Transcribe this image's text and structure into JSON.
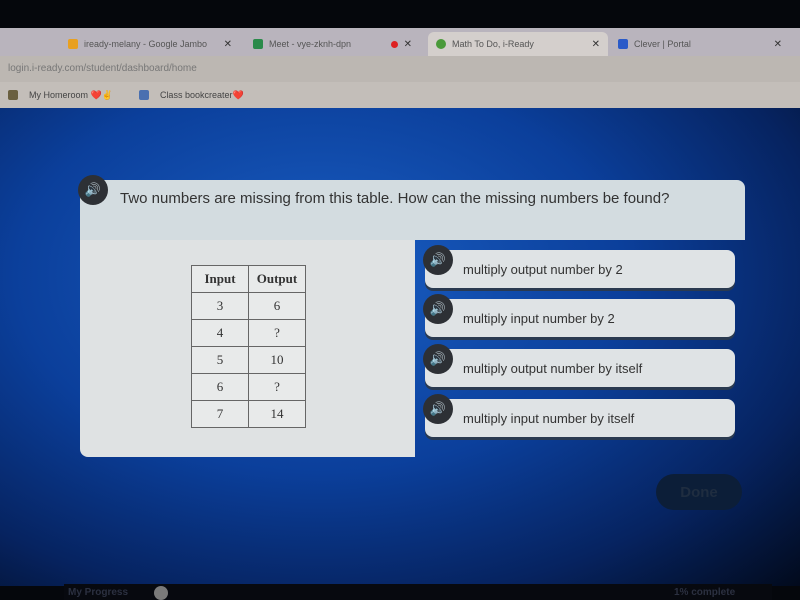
{
  "browser": {
    "tabs": [
      {
        "label": "iready-melany - Google Jambo",
        "active": false
      },
      {
        "label": "Meet - vye-zknh-dpn",
        "active": false
      },
      {
        "label": "Math To Do, i-Ready",
        "active": true
      },
      {
        "label": "Clever | Portal",
        "active": false
      }
    ],
    "url": "login.i-ready.com/student/dashboard/home",
    "bookmarks": [
      "My Homeroom ❤️✌",
      "Class bookcreater❤️"
    ]
  },
  "question": {
    "text": "Two numbers are missing from this table. How can the missing numbers be found?"
  },
  "table": {
    "headers": [
      "Input",
      "Output"
    ],
    "rows": [
      [
        "3",
        "6"
      ],
      [
        "4",
        "?"
      ],
      [
        "5",
        "10"
      ],
      [
        "6",
        "?"
      ],
      [
        "7",
        "14"
      ]
    ]
  },
  "options": [
    "multiply output number by 2",
    "multiply input number by 2",
    "multiply output number by itself",
    "multiply input number by itself"
  ],
  "done_label": "Done",
  "progress": {
    "label": "My Progress",
    "status": "1% complete",
    "percent": 1
  }
}
